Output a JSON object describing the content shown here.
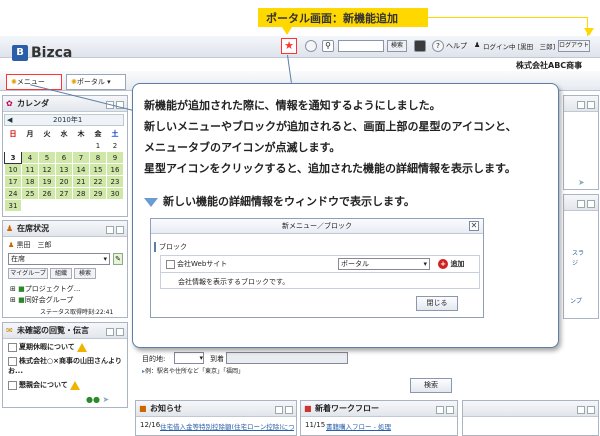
{
  "banner": {
    "title": "ポータル画面：新機能追加"
  },
  "app": {
    "logo": "Bizca",
    "logo_mark": "B",
    "company": "株式会社ABC商事"
  },
  "toolbar": {
    "search_button": "検索",
    "help": "ヘルプ",
    "login_status": "ログイン中 [黒田　三郎]",
    "logout": "ログアウト"
  },
  "tabs": {
    "menu": "メニュー",
    "portal": "ポータル"
  },
  "calendar": {
    "title": "カレンダ",
    "month": "2010年1",
    "weekdays": [
      "日",
      "月",
      "火",
      "水",
      "木",
      "金",
      "土"
    ],
    "rows": [
      [
        "",
        "",
        "",
        "",
        "",
        "1",
        "2"
      ],
      [
        "3",
        "4",
        "5",
        "6",
        "7",
        "8",
        "9"
      ],
      [
        "10",
        "11",
        "12",
        "13",
        "14",
        "15",
        "16"
      ],
      [
        "17",
        "18",
        "19",
        "20",
        "21",
        "22",
        "23"
      ],
      [
        "24",
        "25",
        "26",
        "27",
        "28",
        "29",
        "30"
      ],
      [
        "31",
        "",
        "",
        "",
        "",
        "",
        ""
      ]
    ]
  },
  "presence": {
    "title": "在席状況",
    "user": "黒田　三郎",
    "status": "在席",
    "subtabs": [
      "マイグループ",
      "組織",
      "検索"
    ],
    "groups": [
      "プロジェクトグ...",
      "同好会グループ"
    ],
    "updated": "ステータス取得時刻:22:41"
  },
  "unconfirmed": {
    "title": "未確認の回覧・伝言",
    "items": [
      "夏期休暇について",
      "株式会社○×商事の山田さんよりお...",
      "懇親会について"
    ]
  },
  "search_panel": {
    "destination_label": "目的地:",
    "arrival": "到着",
    "example": "例：駅名や住所など「東京」「福岡」",
    "search_button": "検索"
  },
  "right_fragments": {
    "a": "スラ",
    "b": "ジ",
    "c": "ンプ"
  },
  "news": {
    "title": "お知らせ",
    "date": "12/16",
    "text": "住宅借入金等特別控除額(住宅ローン控除)について"
  },
  "workflow": {
    "title": "新着ワークフロー",
    "date": "11/15",
    "text": "書籍購入フロー - 処理"
  },
  "callout": {
    "lines": [
      "新機能が追加された際に、情報を通知するようにしました。",
      "新しいメニューやブロックが追加されると、画面上部の星型のアイコンと、",
      "メニュータブのアイコンが点滅します。",
      "星型アイコンをクリックすると、追加された機能の詳細情報を表示します。"
    ],
    "sub_heading": "新しい機能の詳細情報をウィンドウで表示します。"
  },
  "popup": {
    "title": "新メニュー／ブロック",
    "section": "ブロック",
    "item_name": "会社Webサイト",
    "target_select": "ポータル",
    "add_button": "追加",
    "description": "会社情報を表示するブロックです。",
    "close_button": "閉じる"
  },
  "colors": {
    "accent": "#ffd800",
    "star": "#ff3333",
    "callout_border": "#5b7fa8",
    "calendar_green": "#cfe8a8"
  }
}
